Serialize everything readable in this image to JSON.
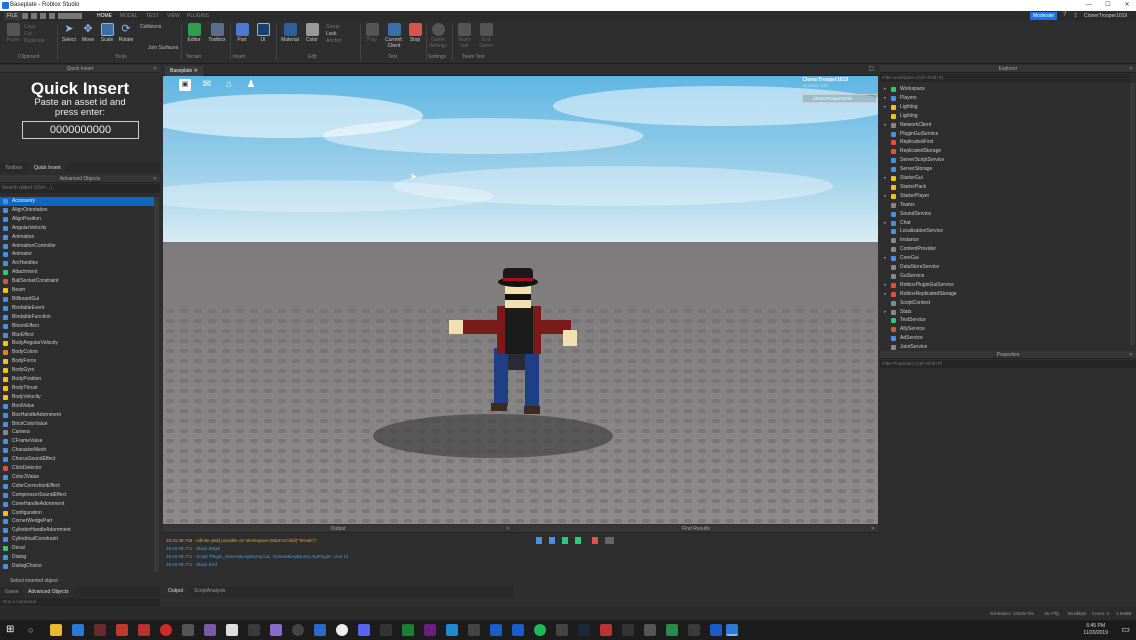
{
  "window": {
    "title": "Baseplate - Roblox Studio",
    "icon": "roblox-studio-icon",
    "min": "—",
    "max": "☐",
    "close": "✕"
  },
  "menu": {
    "tabs": [
      "FILE",
      "HOME",
      "MODEL",
      "TEST",
      "VIEW",
      "PLUGINS"
    ],
    "active": "HOME"
  },
  "ribbon": {
    "clipboard": {
      "items": [
        "Paste",
        "Copy",
        "Cut",
        "Duplicate"
      ],
      "group": "Clipboard"
    },
    "tools": {
      "items": [
        "Select",
        "Move",
        "Scale",
        "Rotate"
      ],
      "collisions": "Collisions",
      "join": "Join Surfaces",
      "group": "Tools"
    },
    "terrain": {
      "items": [
        "Editor",
        "Toolbox"
      ],
      "group": "Terrain"
    },
    "insert": {
      "items": [
        "Part",
        "UI"
      ],
      "group": "Insert"
    },
    "edit": {
      "items": [
        "Material",
        "Color",
        "Group",
        "Lock",
        "Anchor"
      ],
      "group": "Edit"
    },
    "test": {
      "items": [
        "Play",
        "Current: Client",
        "Stop"
      ],
      "group": "Test"
    },
    "settings": {
      "items": [
        "Game Settings"
      ],
      "group": "Settings"
    },
    "teamtest": {
      "items": [
        "Team Test",
        "Exit Game"
      ],
      "group": "Team Test"
    },
    "user": {
      "role": "Moderate",
      "name": "ClonerTrooper1019"
    }
  },
  "quickInsert": {
    "header": "Quick Insert",
    "title": "Quick Insert",
    "sub1": "Paste an asset id and",
    "sub2": "press enter:",
    "placeholder": "0000000000"
  },
  "leftTabs": [
    "Toolbox",
    "Quick Insert"
  ],
  "advancedObjects": {
    "header": "Advanced Objects",
    "filter": "Search object (Ctrl+...)",
    "items": [
      {
        "name": "Accessory",
        "color": "#4a90e2",
        "selected": true
      },
      {
        "name": "AlignOrientation",
        "color": "#4a90e2"
      },
      {
        "name": "AlignPosition",
        "color": "#4a90e2"
      },
      {
        "name": "AngularVelocity",
        "color": "#4a90e2"
      },
      {
        "name": "Animation",
        "color": "#4a90e2"
      },
      {
        "name": "AnimationController",
        "color": "#4a90e2"
      },
      {
        "name": "Animator",
        "color": "#4a90e2"
      },
      {
        "name": "ArcHandles",
        "color": "#4a90e2"
      },
      {
        "name": "Attachment",
        "color": "#2ecc71"
      },
      {
        "name": "BallSocketConstraint",
        "color": "#e74c3c"
      },
      {
        "name": "Beam",
        "color": "#f1c40f"
      },
      {
        "name": "BillboardGui",
        "color": "#4a90e2"
      },
      {
        "name": "BindableEvent",
        "color": "#4a90e2"
      },
      {
        "name": "BindableFunction",
        "color": "#4a90e2"
      },
      {
        "name": "BloomEffect",
        "color": "#4a90e2"
      },
      {
        "name": "BlurEffect",
        "color": "#4a90e2"
      },
      {
        "name": "BodyAngularVelocity",
        "color": "#f1c40f"
      },
      {
        "name": "BodyColors",
        "color": "#e67e22"
      },
      {
        "name": "BodyForce",
        "color": "#f1c40f"
      },
      {
        "name": "BodyGyro",
        "color": "#f1c40f"
      },
      {
        "name": "BodyPosition",
        "color": "#f1c40f"
      },
      {
        "name": "BodyThrust",
        "color": "#f1c40f"
      },
      {
        "name": "BodyVelocity",
        "color": "#f1c40f"
      },
      {
        "name": "BoolValue",
        "color": "#4a90e2"
      },
      {
        "name": "BoxHandleAdornment",
        "color": "#4a90e2"
      },
      {
        "name": "BrickColorValue",
        "color": "#4a90e2"
      },
      {
        "name": "Camera",
        "color": "#888888"
      },
      {
        "name": "CFrameValue",
        "color": "#4a90e2"
      },
      {
        "name": "CharacterMesh",
        "color": "#4a90e2"
      },
      {
        "name": "ChorusSoundEffect",
        "color": "#4a90e2"
      },
      {
        "name": "ClickDetector",
        "color": "#e74c3c"
      },
      {
        "name": "Color3Value",
        "color": "#4a90e2"
      },
      {
        "name": "ColorCorrectionEffect",
        "color": "#4a90e2"
      },
      {
        "name": "CompressorSoundEffect",
        "color": "#4a90e2"
      },
      {
        "name": "ConeHandleAdornment",
        "color": "#4a90e2"
      },
      {
        "name": "Configuration",
        "color": "#f1c40f"
      },
      {
        "name": "CornerWedgePart",
        "color": "#4a90e2"
      },
      {
        "name": "CylinderHandleAdornment",
        "color": "#4a90e2"
      },
      {
        "name": "CylindricalConstraint",
        "color": "#4a90e2"
      },
      {
        "name": "Decal",
        "color": "#2ecc71"
      },
      {
        "name": "Dialog",
        "color": "#4a90e2"
      },
      {
        "name": "DialogChoice",
        "color": "#4a90e2"
      }
    ],
    "selectInserted": "Select inserted object"
  },
  "bottomTabs": [
    "Game",
    "Advanced Objects"
  ],
  "statusLeft": "Run a command",
  "viewport": {
    "tab": "Baseplate",
    "user": "ClonerTrooper1019",
    "account": "Account: 13+",
    "playerList": "ClonerTrooper1019"
  },
  "output": {
    "header": "Output",
    "lines": [
      {
        "text": "18:41:48.748 - Infinite yield possible on 'Workspace:WaitForChild(\"Terrain\")'",
        "color": "#e8a23a"
      },
      {
        "text": "18:40:48.771 - Stack Begin",
        "color": "#4d9de0"
      },
      {
        "text": "18:40:48.771 - Script 'Plugin_GenerateApiDump.lua', GenerateApiDump.ApiPlugin', Line 12",
        "color": "#4d9de0"
      },
      {
        "text": "18:40:48.771 - Stack End",
        "color": "#4d9de0"
      }
    ],
    "tabs": [
      "Output",
      "ScriptAnalysis"
    ]
  },
  "findResults": {
    "header": "Find Results"
  },
  "explorer": {
    "header": "Explorer",
    "filter": "Filter workspace (Ctrl+Shift+X)",
    "items": [
      {
        "name": "Workspace",
        "color": "#2ecc71",
        "arrow": "▸"
      },
      {
        "name": "Players",
        "color": "#4a90e2",
        "arrow": "▸"
      },
      {
        "name": "Lighting",
        "color": "#f1c40f",
        "arrow": "▸"
      },
      {
        "name": "Lighting",
        "color": "#f1c40f",
        "arrow": ""
      },
      {
        "name": "NetworkClient",
        "color": "#888888",
        "arrow": "▸"
      },
      {
        "name": "PluginGuiService",
        "color": "#4a90e2",
        "arrow": ""
      },
      {
        "name": "ReplicatedFirst",
        "color": "#e74c3c",
        "arrow": ""
      },
      {
        "name": "ReplicatedStorage",
        "color": "#e74c3c",
        "arrow": ""
      },
      {
        "name": "ServerScriptService",
        "color": "#4a90e2",
        "arrow": ""
      },
      {
        "name": "ServerStorage",
        "color": "#4a90e2",
        "arrow": ""
      },
      {
        "name": "StarterGui",
        "color": "#f1c40f",
        "arrow": "▸"
      },
      {
        "name": "StarterPack",
        "color": "#f1c40f",
        "arrow": ""
      },
      {
        "name": "StarterPlayer",
        "color": "#f1c40f",
        "arrow": "▸"
      },
      {
        "name": "Teams",
        "color": "#888888",
        "arrow": ""
      },
      {
        "name": "SoundService",
        "color": "#4a90e2",
        "arrow": ""
      },
      {
        "name": "Chat",
        "color": "#4a90e2",
        "arrow": "▸"
      },
      {
        "name": "LocalizationService",
        "color": "#4a90e2",
        "arrow": ""
      },
      {
        "name": "Instance",
        "color": "#888888",
        "arrow": ""
      },
      {
        "name": "ContentProvider",
        "color": "#888888",
        "arrow": ""
      },
      {
        "name": "CoreGui",
        "color": "#4a90e2",
        "arrow": "▸"
      },
      {
        "name": "DataStoreService",
        "color": "#888888",
        "arrow": ""
      },
      {
        "name": "GuiService",
        "color": "#888888",
        "arrow": ""
      },
      {
        "name": "RobloxPluginGuiService",
        "color": "#e74c3c",
        "arrow": "▸"
      },
      {
        "name": "RobloxReplicatedStorage",
        "color": "#e74c3c",
        "arrow": "▸"
      },
      {
        "name": "ScriptContext",
        "color": "#888888",
        "arrow": ""
      },
      {
        "name": "Stats",
        "color": "#888888",
        "arrow": "▸"
      },
      {
        "name": "TestService",
        "color": "#2ecc71",
        "arrow": ""
      },
      {
        "name": "AllyService",
        "color": "#e74c3c",
        "arrow": ""
      },
      {
        "name": "AdService",
        "color": "#4a90e2",
        "arrow": ""
      },
      {
        "name": "JointService",
        "color": "#888888",
        "arrow": ""
      }
    ]
  },
  "properties": {
    "header": "Properties",
    "filter": "Filter Properties (Ctrl+Shift+P)"
  },
  "statusbar": {
    "schedule": "Scheduler: 1234/s 0%",
    "sleep": "15.77fp",
    "kbps": "50.8kbps",
    "cores": "Cores: 4",
    "mem": "1.04MB"
  },
  "clock": {
    "time": "6:45 PM",
    "date": "11/20/2019"
  }
}
